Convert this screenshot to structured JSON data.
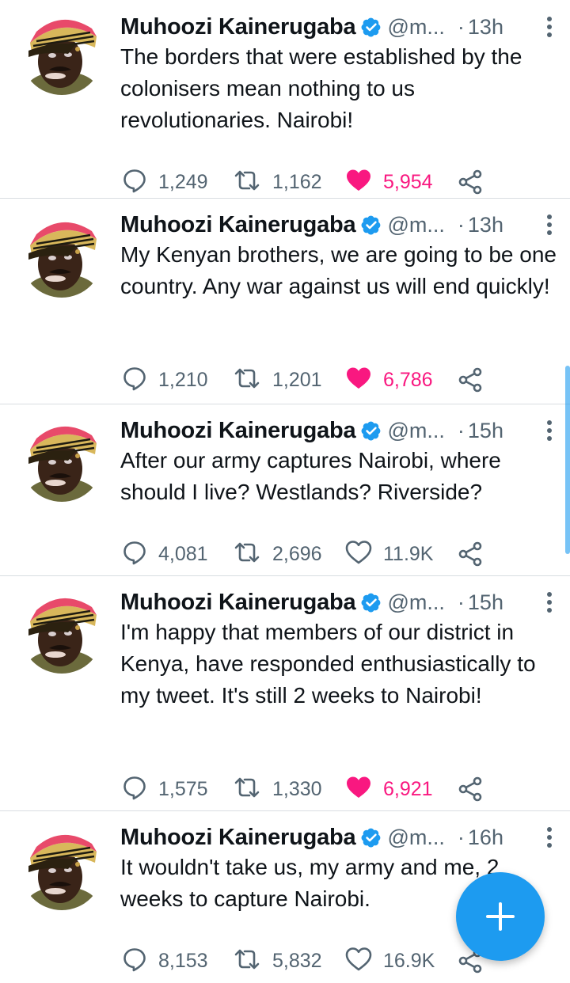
{
  "tweets": [
    {
      "name": "Muhoozi Kainerugaba",
      "handle": "@m...",
      "time": "13h",
      "text": "The borders that were established by the colonisers mean nothing to us revolutionaries. Nairobi!",
      "replies": "1,249",
      "retweets": "1,162",
      "likes": "5,954",
      "liked": true
    },
    {
      "name": "Muhoozi Kainerugaba",
      "handle": "@m...",
      "time": "13h",
      "text": "My Kenyan brothers, we are going to be one country. Any war against us will end quickly!",
      "replies": "1,210",
      "retweets": "1,201",
      "likes": "6,786",
      "liked": true
    },
    {
      "name": "Muhoozi Kainerugaba",
      "handle": "@m...",
      "time": "15h",
      "text": "After our army captures Nairobi, where should I live? Westlands? Riverside?",
      "replies": "4,081",
      "retweets": "2,696",
      "likes": "11.9K",
      "liked": false
    },
    {
      "name": "Muhoozi Kainerugaba",
      "handle": "@m...",
      "time": "15h",
      "text": "I'm happy that members of our district in Kenya, have responded enthusiastically to my tweet. It's still 2 weeks to Nairobi!",
      "replies": "1,575",
      "retweets": "1,330",
      "likes": "6,921",
      "liked": true
    },
    {
      "name": "Muhoozi Kainerugaba",
      "handle": "@m...",
      "time": "16h",
      "text": "It wouldn't take us, my army and me, 2 weeks to capture Nairobi.",
      "replies": "8,153",
      "retweets": "5,832",
      "likes": "16.9K",
      "liked": false
    }
  ],
  "icons": {
    "verified": "verified-badge-icon",
    "more": "more-vertical-icon",
    "reply": "reply-icon",
    "retweet": "retweet-icon",
    "like": "heart-icon",
    "share": "share-icon",
    "compose": "plus-icon"
  },
  "colors": {
    "accent": "#1d9bf0",
    "like": "#f91880",
    "muted": "#536471",
    "text": "#0f1419"
  }
}
